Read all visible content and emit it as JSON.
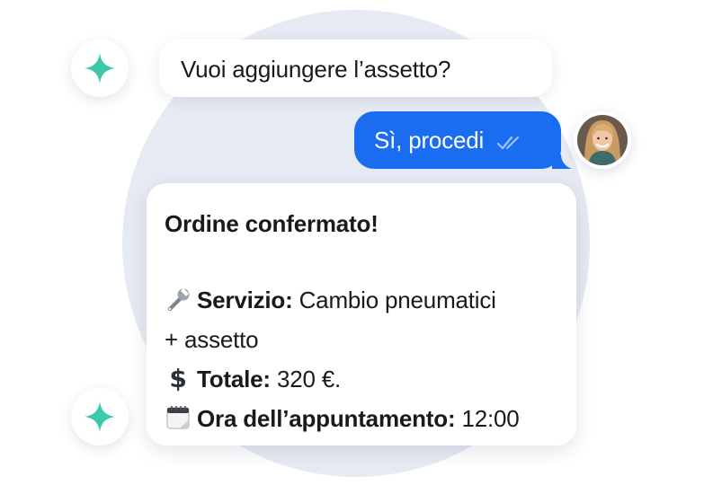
{
  "messages": {
    "bot_question": "Vuoi aggiungere l’assetto?",
    "user_reply": "Sì, procedi",
    "confirmation": {
      "title": "Ordine confermato!",
      "service_label": "Servizio:",
      "service_value": "Cambio pneumatici",
      "service_value_cont": "+ assetto",
      "total_label": "Totale:",
      "total_value": "320 €.",
      "time_label": "Ora dell’appuntamento:",
      "time_value": "12:00"
    }
  },
  "icons": {
    "bot_avatar": "sparkle-icon",
    "read_receipt": "double-check-icon",
    "service": "wrench-icon",
    "total": "dollar-icon",
    "time": "calendar-icon"
  },
  "colors": {
    "user_bubble": "#1a6cf0",
    "sparkle": "#3cc9a8",
    "background_circle": "#e6eaf2"
  }
}
